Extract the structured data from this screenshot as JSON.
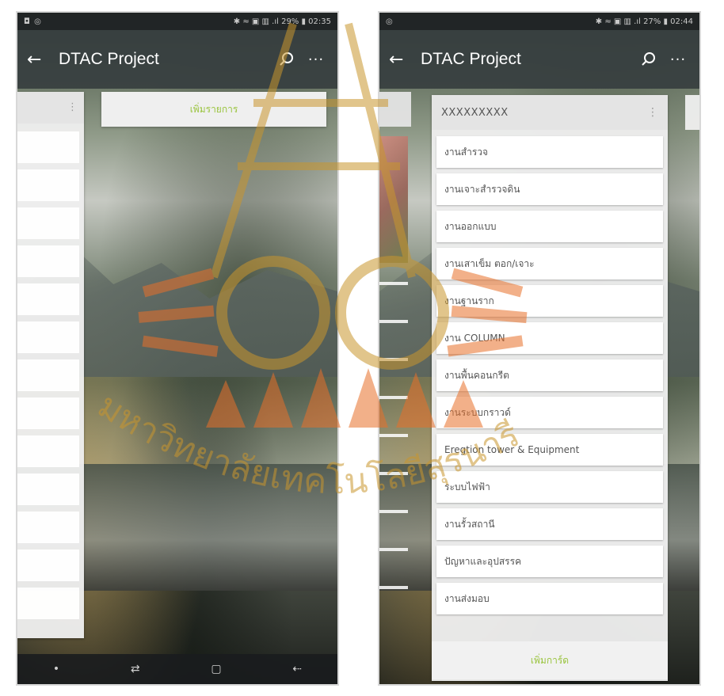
{
  "left_screen": {
    "status": {
      "left": "◘ ◎",
      "right": "✱ ≈ ▣ ▥ .ıl 29% ▮ 02:35"
    },
    "app_bar": {
      "back_icon": "arrow-left-icon",
      "title": "DTAC Project",
      "search_icon": "search-icon",
      "more_icon": "more-dots-icon",
      "more_glyph": "···",
      "back_glyph": "←"
    },
    "add_list_label": "เพิ่มรายการ",
    "nav": {
      "back": "•",
      "recent": "⇄",
      "home": "▢",
      "return": "⇠"
    }
  },
  "right_screen": {
    "status": {
      "left": "◎",
      "right": "✱ ≈ ▣ ▥ .ıl 27% ▮ 02:44"
    },
    "app_bar": {
      "back_icon": "arrow-left-icon",
      "title": "DTAC Project",
      "search_icon": "search-icon",
      "more_icon": "more-dots-icon",
      "more_glyph": "···",
      "back_glyph": "←"
    },
    "list": {
      "name": "XXXXXXXXX",
      "menu_glyph": "⋮",
      "cards": [
        "งานสำรวจ",
        "งานเจาะสำรวจดิน",
        "งานออกแบบ",
        "งานเสาเข็ม ตอก/เจาะ",
        "งานฐานราก",
        "งาน COLUMN",
        "งานพื้นคอนกรีต",
        "งานระบบกราวด์",
        "Eregtion tower & Equipment",
        "ระบบไฟฟ้า",
        "งานรั้วสถานี",
        "ปัญหาและอุปสรรค",
        "งานส่งมอบ"
      ],
      "add_card_label": "เพิ่มการ์ด"
    }
  },
  "watermark": {
    "text": "มหาวิทยาลัยเทคโนโลยีสุรนารี",
    "colors": {
      "orange": "#e8702a",
      "gold": "#c9962e"
    }
  },
  "colors": {
    "app_bar": "#373e40",
    "accent_green": "#9ac43e",
    "card": "#ffffff"
  }
}
